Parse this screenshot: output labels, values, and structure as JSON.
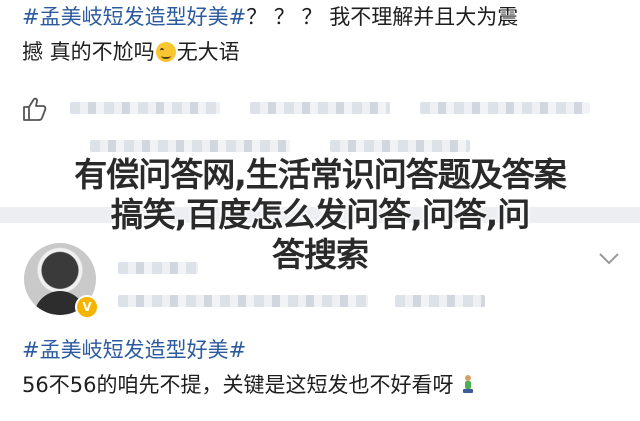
{
  "post1": {
    "hashtag": "#孟美岐短发造型好美#",
    "text_line1_rest": "？ ？ ？ 我不理解并且大为震",
    "text_line2_pre": "撼 真的不尬吗",
    "text_line2_post": "无大语",
    "emoji_icon": "grinning-sweat-emoji"
  },
  "watermark": {
    "line1": "有偿问答网,生活常识问答题及答案",
    "line2": "搞笑,百度怎么发问答,问答,问",
    "line3": "答搜索"
  },
  "post2": {
    "hashtag": "#孟美岐短发造型好美#",
    "text": "56不56的咱先不提，关键是这短发也不好看呀"
  },
  "colors": {
    "hashtag": "#2b5a9e",
    "divider": "#eceef1",
    "verified_badge": "#f4b400"
  }
}
